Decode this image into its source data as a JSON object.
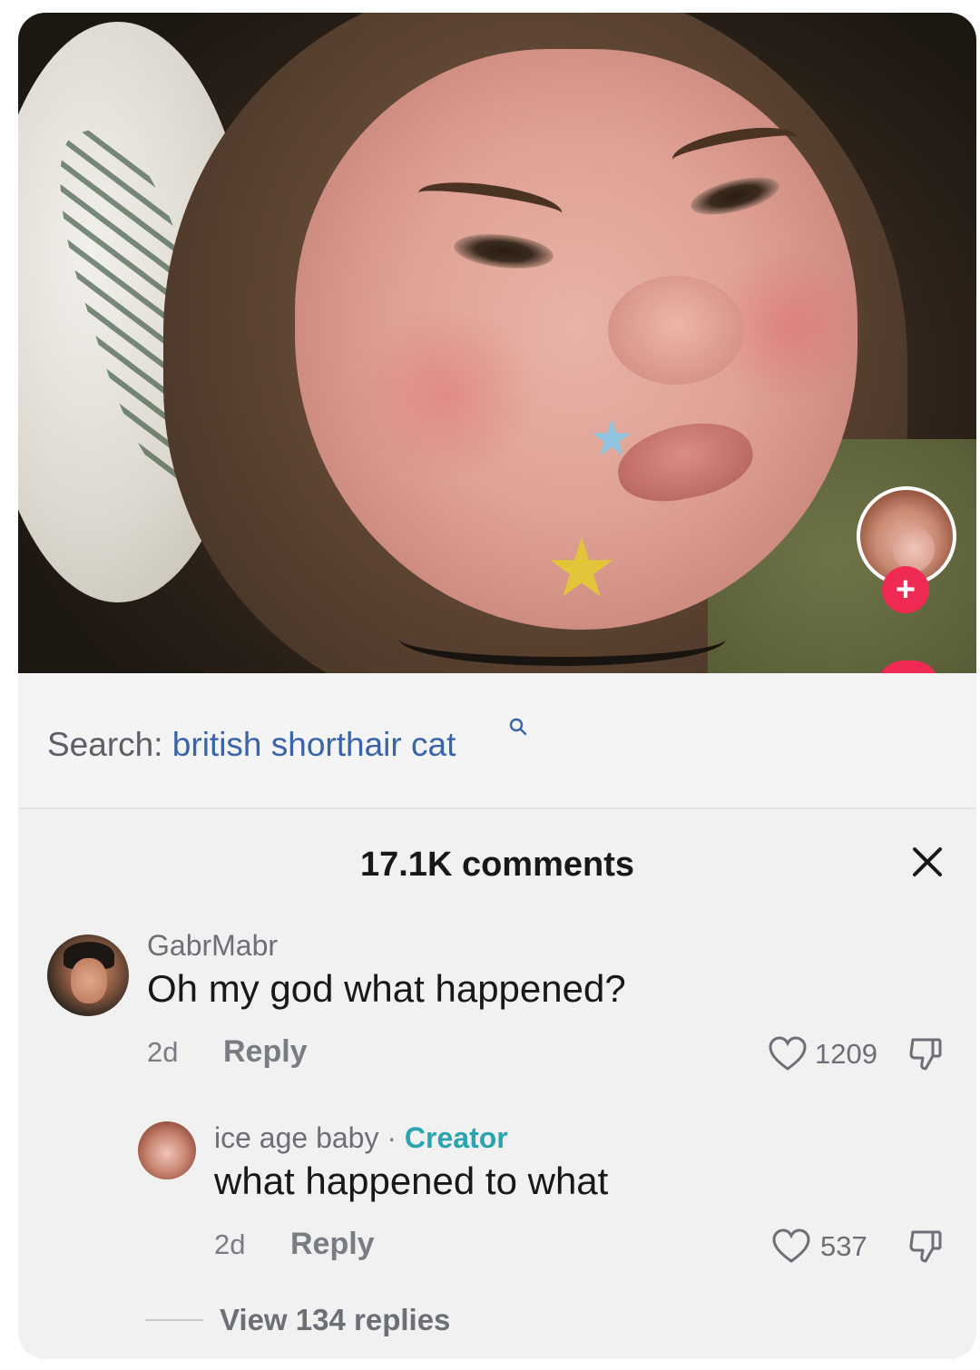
{
  "search": {
    "prefix": "Search:",
    "term": "british shorthair cat"
  },
  "comments_sheet": {
    "title": "17.1K comments"
  },
  "comments": [
    {
      "username": "GabrMabr",
      "text": "Oh my god what happened?",
      "time": "2d",
      "reply_label": "Reply",
      "likes": "1209"
    }
  ],
  "reply": {
    "username": "ice age baby",
    "separator": "·",
    "badge": "Creator",
    "text": "what happened to what",
    "time": "2d",
    "reply_label": "Reply",
    "likes": "537"
  },
  "view_replies": "View 134 replies",
  "colors": {
    "accent_red": "#ef2b55",
    "search_term": "#3a64a8",
    "creator_badge": "#2aa5b0"
  },
  "icons": [
    "plus-icon",
    "search-icon",
    "close-icon",
    "heart-icon",
    "dislike-icon"
  ]
}
